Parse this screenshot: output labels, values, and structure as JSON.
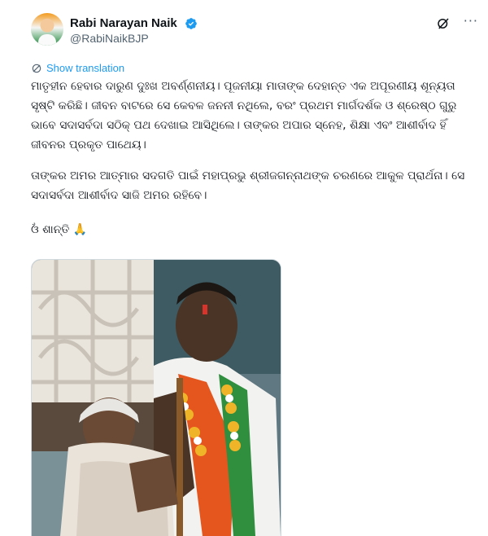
{
  "author": {
    "name": "Rabi Narayan Naik",
    "handle": "@RabiNaikBJP",
    "avatar_icon": "avatar-photo",
    "verified_icon": "verified-badge-icon",
    "verified_color": "#1d9bf0"
  },
  "actions": {
    "grok_icon": "grok-icon",
    "more_icon": "more-options-icon",
    "more_glyph": "···"
  },
  "translation": {
    "label": "Show translation",
    "color": "#1d9bf0"
  },
  "post": {
    "paragraph1": "ମାତୃହୀନ ହେବାର ଦାରୁଣ ଦୁଃଖ ଅବର୍ଣ୍ଣନୀୟ। ପୂଜନୀୟା ମାତାଙ୍କ ଦେହାନ୍ତ ଏକ ଅପୂରଣୀୟ ଶୂନ୍ୟତା ସୃଷ୍ଟି କରିଛି। ଜୀବନ ବାଟରେ ସେ କେବଳ ଜନନୀ ନଥିଲେ, ବରଂ ପ୍ରଥମ ମାର୍ଗଦର୍ଶକ ଓ ଶ୍ରେଷ୍ଠ ଗୁରୁ ଭାବେ ସଦାସର୍ବଦା ସଠିକ୍ ପଥ ଦେଖାଇ ଆସିଥିଲେ। ତାଙ୍କର ଅପାର ସ୍ନେହ, ଶିକ୍ଷା ଏବଂ ଆଶୀର୍ବାଦ ହିଁ ଜୀବନର ପ୍ରକୃତ ପାଥେୟ।",
    "paragraph2": "ତାଙ୍କର ଅମର ଆତ୍ମାର ସଦଗତି ପାଇଁ ମହାପ୍ରଭୁ ଶ୍ରୀଜଗନ୍ନାଥଙ୍କ ଚରଣରେ ଆକୁଳ ପ୍ରାର୍ଥନା। ସେ ସଦାସର୍ବଦା ଆଶୀର୍ବାଦ ସାଜି ଅମର ରହିବେ।",
    "paragraph3": "ଓଁ ଶାନ୍ତି 🙏"
  },
  "media": {
    "type": "photo",
    "description_icon": "post-photo"
  }
}
